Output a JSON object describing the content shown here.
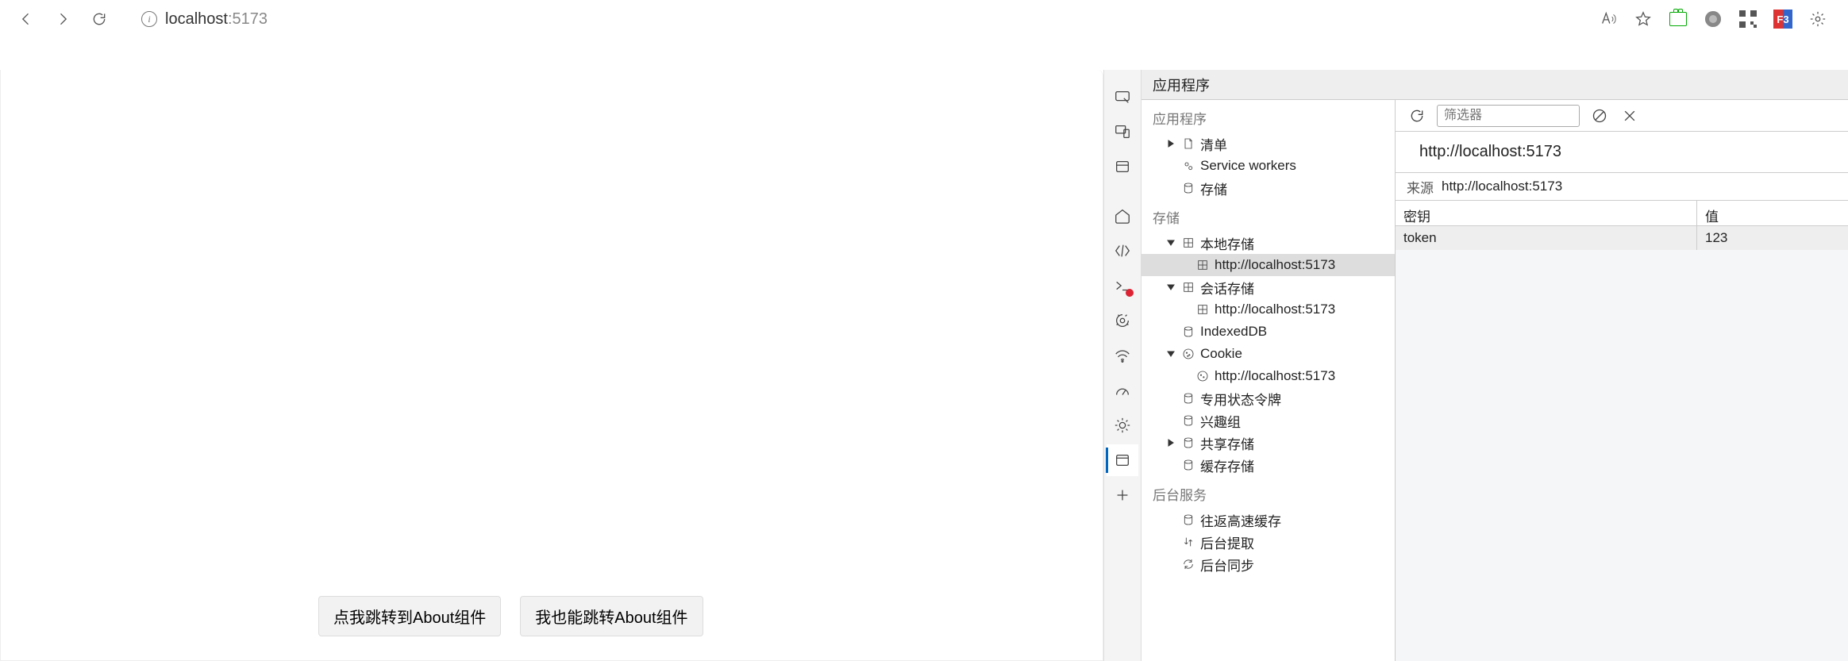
{
  "address": {
    "host": "localhost",
    "port": ":5173"
  },
  "page": {
    "button1": "点我跳转到About组件",
    "button2": "我也能跳转About组件"
  },
  "devtools": {
    "tab_title": "应用程序",
    "filter_placeholder": "筛选器",
    "tree": {
      "section_app": "应用程序",
      "manifest": "清单",
      "service_workers": "Service workers",
      "storage": "存储",
      "section_storage": "存储",
      "local_storage": "本地存储",
      "local_storage_origin": "http://localhost:5173",
      "session_storage": "会话存储",
      "session_storage_origin": "http://localhost:5173",
      "indexeddb": "IndexedDB",
      "cookie": "Cookie",
      "cookie_origin": "http://localhost:5173",
      "trust_tokens": "专用状态令牌",
      "interest_groups": "兴趣组",
      "shared_storage": "共享存储",
      "cache_storage": "缓存存储",
      "section_bg": "后台服务",
      "back_forward_cache": "往返高速缓存",
      "background_fetch": "后台提取",
      "background_sync": "后台同步"
    },
    "right": {
      "title": "http://localhost:5173",
      "origin_label": "来源",
      "origin_value": "http://localhost:5173",
      "col_key": "密钥",
      "col_val": "值",
      "rows": [
        {
          "key": "token",
          "value": "123"
        }
      ]
    }
  }
}
